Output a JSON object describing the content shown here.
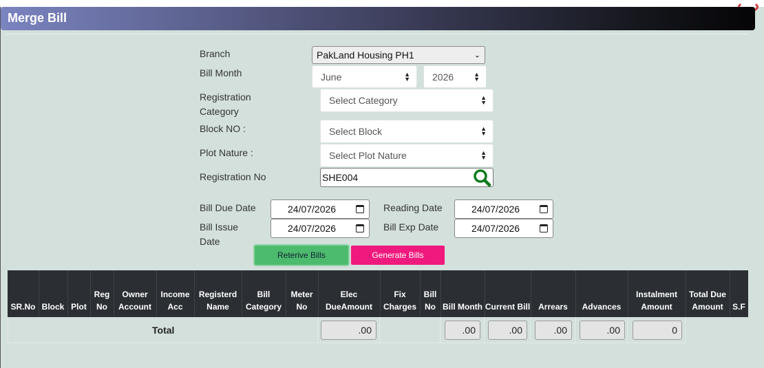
{
  "header": {
    "title": "Merge Bill"
  },
  "form": {
    "branch": {
      "label": "Branch",
      "value": "PakLand Housing PH1"
    },
    "bill_month": {
      "label": "Bill Month",
      "month": "June",
      "year": "2026"
    },
    "registration_category": {
      "label": "Registration Category",
      "value": "Select Category"
    },
    "block_no": {
      "label": "Block NO :",
      "value": "Select Block"
    },
    "plot_nature": {
      "label": "Plot Nature :",
      "value": "Select Plot Nature"
    },
    "registration_no": {
      "label": "Registration No",
      "value": "SHE004"
    },
    "bill_due_date": {
      "label": "Bill Due Date",
      "value": "24/07/2026"
    },
    "reading_date": {
      "label": "Reading Date",
      "value": "24/07/2026"
    },
    "bill_issue_date": {
      "label": "Bill Issue Date",
      "value": "24/07/2026"
    },
    "bill_exp_date": {
      "label": "Bill Exp Date",
      "value": "24/07/2026"
    }
  },
  "buttons": {
    "retrieve": "Reterive Bills",
    "generate": "Generate Bills"
  },
  "table": {
    "columns": [
      "SR.No",
      "Block",
      "Plot",
      "Reg No",
      "Owner Account",
      "Income Acc",
      "Registerd Name",
      "Bill Category",
      "Meter No",
      "Elec DueAmount",
      "Fix Charges",
      "Bill No",
      "Bill Month",
      "Current Bill",
      "Arrears",
      "Advances",
      "Instalment Amount",
      "Total Due Amount",
      "S.F"
    ],
    "total_label": "Total",
    "totals": {
      "elec_due": ".00",
      "bill_month": ".00",
      "current_bill": ".00",
      "arrears": ".00",
      "advances": ".00",
      "instalment": "0"
    }
  },
  "colors": {
    "page_bg": "#d3e0dc",
    "retrieve_btn": "#4dbb6e",
    "generate_btn": "#f0197d",
    "table_header": "#2b2f33"
  },
  "icons": {
    "search": "magnifier-icon",
    "calendar": "calendar-icon"
  }
}
